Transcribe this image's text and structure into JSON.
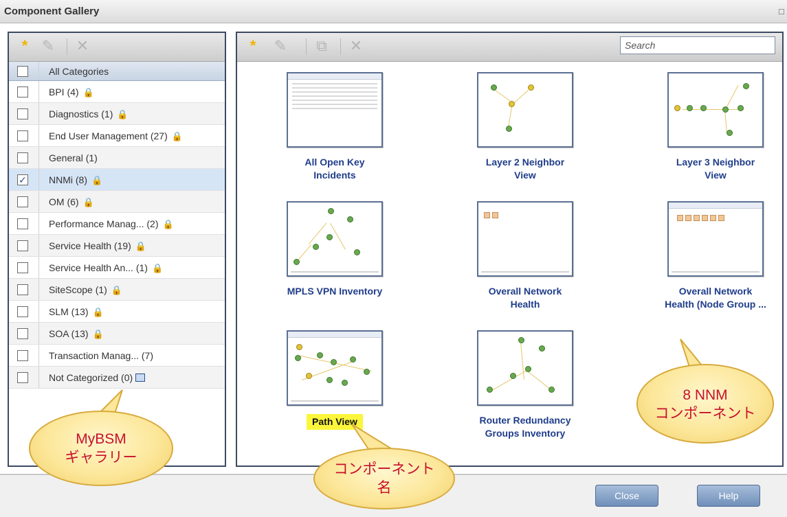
{
  "window": {
    "title": "Component Gallery",
    "maximize_glyph": "□ x"
  },
  "left_panel": {
    "toolbar": {
      "new_icon": "*",
      "edit_icon": "✎",
      "delete_icon": "✕"
    },
    "header_label": "All Categories",
    "categories": [
      {
        "label": "BPI (4)",
        "locked": true,
        "checked": false
      },
      {
        "label": "Diagnostics (1)",
        "locked": true,
        "checked": false
      },
      {
        "label": "End User Management (27)",
        "locked": true,
        "checked": false
      },
      {
        "label": "General (1)",
        "locked": false,
        "checked": false
      },
      {
        "label": "NNMi (8)",
        "locked": true,
        "checked": true
      },
      {
        "label": "OM (6)",
        "locked": true,
        "checked": false
      },
      {
        "label": "Performance Manag... (2)",
        "locked": true,
        "checked": false
      },
      {
        "label": "Service Health (19)",
        "locked": true,
        "checked": false
      },
      {
        "label": "Service Health An... (1)",
        "locked": true,
        "checked": false
      },
      {
        "label": "SiteScope (1)",
        "locked": true,
        "checked": false
      },
      {
        "label": "SLM (13)",
        "locked": true,
        "checked": false
      },
      {
        "label": "SOA (13)",
        "locked": true,
        "checked": false
      },
      {
        "label": "Transaction Manag... (7)",
        "locked": false,
        "checked": false
      },
      {
        "label": "Not Categorized (0)",
        "locked": false,
        "checked": false
      }
    ]
  },
  "right_panel": {
    "toolbar": {
      "new_icon": "*",
      "edit_icon": "✎",
      "copy_icon": "⧉",
      "delete_icon": "✕"
    },
    "search_placeholder": "Search",
    "components": [
      {
        "title_line1": "All Open Key",
        "title_line2": "Incidents",
        "highlighted": false
      },
      {
        "title_line1": "Layer 2 Neighbor",
        "title_line2": "View",
        "highlighted": false
      },
      {
        "title_line1": "Layer 3 Neighbor",
        "title_line2": "View",
        "highlighted": false
      },
      {
        "title_line1": "MPLS VPN Inventory",
        "title_line2": "",
        "highlighted": false
      },
      {
        "title_line1": "Overall Network",
        "title_line2": "Health",
        "highlighted": false
      },
      {
        "title_line1": "Overall Network",
        "title_line2": "Health (Node Group ...",
        "highlighted": false
      },
      {
        "title_line1": "Path View",
        "title_line2": "",
        "highlighted": true
      },
      {
        "title_line1": "Router Redundancy",
        "title_line2": "Groups Inventory",
        "highlighted": false
      }
    ]
  },
  "buttons": {
    "close": "Close",
    "help": "Help"
  },
  "callouts": {
    "mybsm_line1": "MyBSM",
    "mybsm_line2": "ギャラリー",
    "component_name_line1": "コンポーネント",
    "component_name_line2": "名",
    "nnm_line1": "8 NNM",
    "nnm_line2": "コンポーネント"
  },
  "colors": {
    "tile_title": "#1f3d8a",
    "highlight": "#fbf63b",
    "callout_text": "#c8102e",
    "selected_row": "#d6e5f6"
  }
}
